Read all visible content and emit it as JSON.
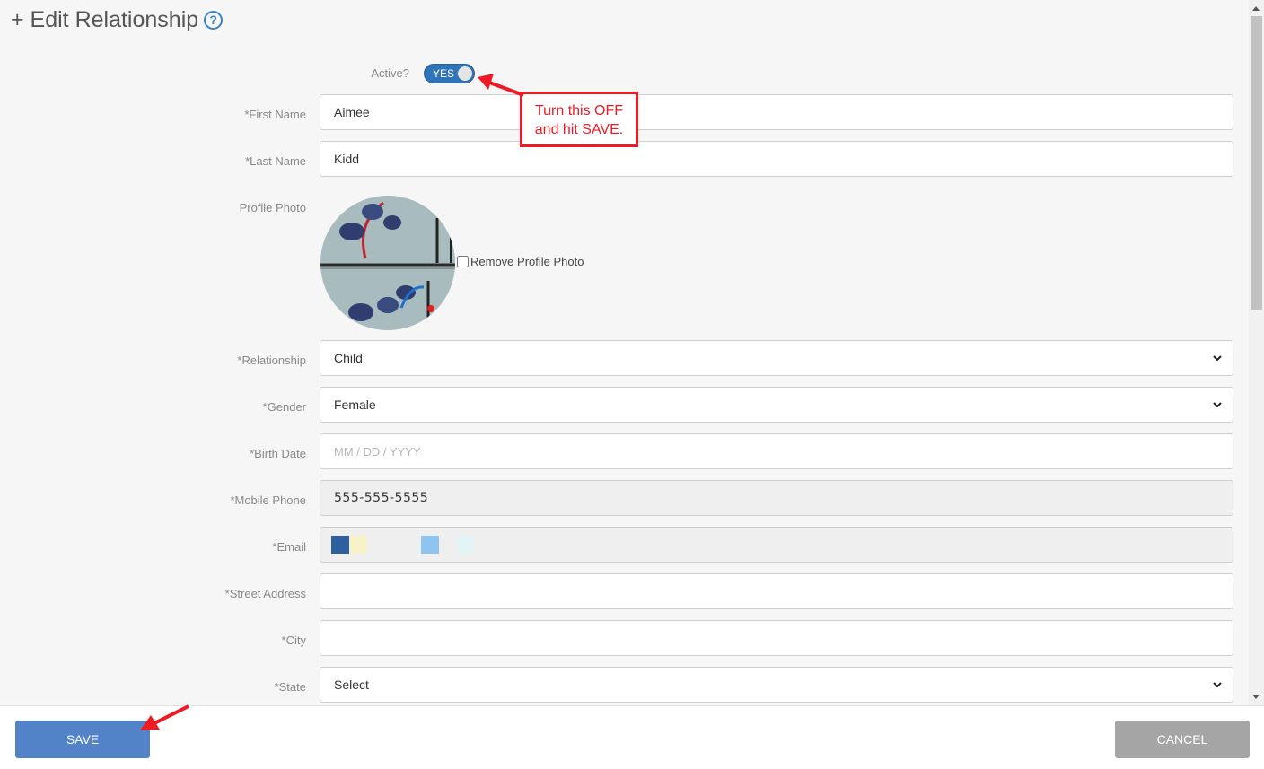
{
  "header": {
    "title": "+ Edit Relationship",
    "help_icon": "?"
  },
  "active": {
    "label": "Active?",
    "toggle_text": "YES"
  },
  "annotation": {
    "line1": "Turn this OFF",
    "line2": "and hit SAVE."
  },
  "form": {
    "first_name": {
      "label": "*First Name",
      "value": "Aimee"
    },
    "last_name": {
      "label": "*Last Name",
      "value": "Kidd"
    },
    "profile_photo": {
      "label": "Profile Photo",
      "remove_label": "Remove Profile Photo"
    },
    "relationship": {
      "label": "*Relationship",
      "value": "Child"
    },
    "gender": {
      "label": "*Gender",
      "value": "Female"
    },
    "birth_date": {
      "label": "*Birth Date",
      "placeholder": "MM / DD / YYYY"
    },
    "mobile_phone": {
      "label": "*Mobile Phone",
      "value": "555-555-5555"
    },
    "email": {
      "label": "*Email",
      "swatch_colors": [
        "#2e5f9e",
        "#f7f2c7",
        "#8ec5f0",
        "#e3f4f6"
      ]
    },
    "street_address": {
      "label": "*Street Address",
      "value": ""
    },
    "city": {
      "label": "*City",
      "value": ""
    },
    "state": {
      "label": "*State",
      "value": "Select"
    }
  },
  "footer": {
    "save_label": "SAVE",
    "cancel_label": "CANCEL"
  },
  "colors": {
    "accent": "#2f73b8",
    "annotation_red": "#ee1b24",
    "save_button": "#5282c7",
    "cancel_button": "#a5a5a5"
  }
}
